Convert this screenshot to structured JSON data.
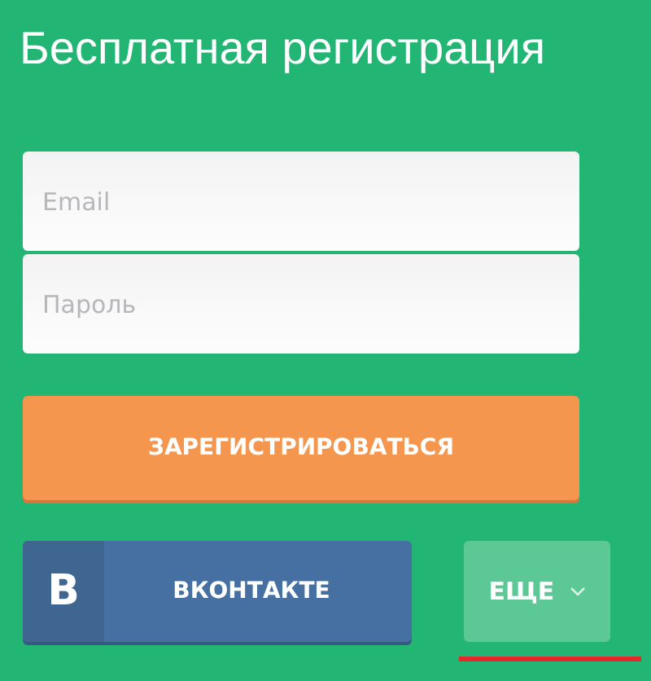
{
  "title": "Бесплатная регистрация",
  "fields": [
    {
      "placeholder": "Email"
    },
    {
      "placeholder": "Пароль"
    }
  ],
  "register_button": "ЗАРЕГИСТРИРОВАТЬСЯ",
  "vk_button": {
    "logo": "B",
    "label": "ВКОНТАКТЕ"
  },
  "more_button": {
    "label": "ЕЩЕ"
  }
}
